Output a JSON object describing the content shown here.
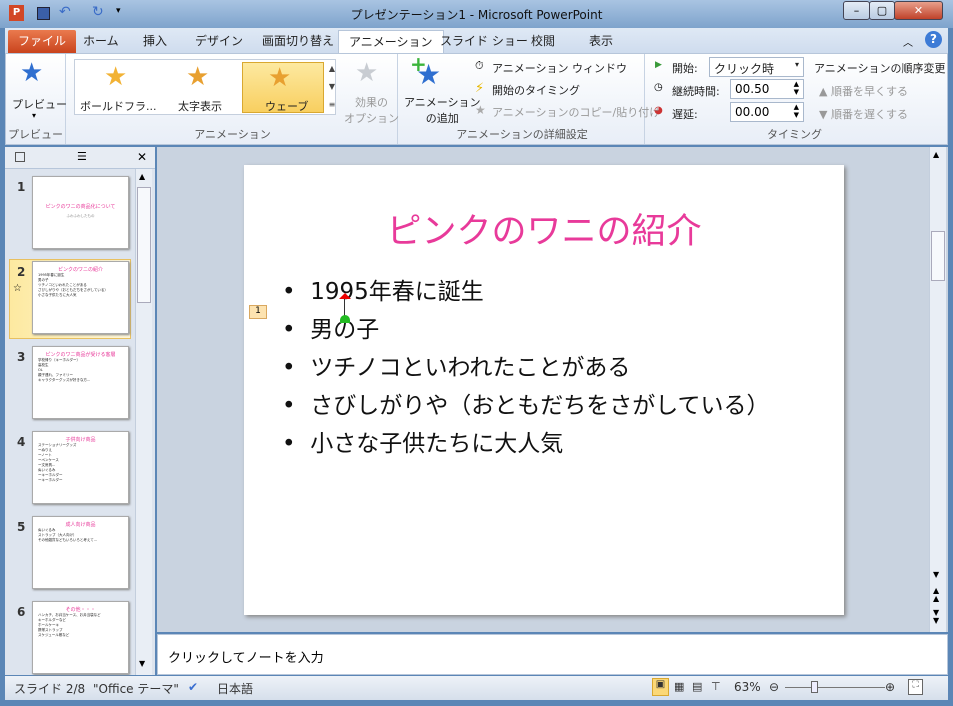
{
  "window": {
    "title": "プレゼンテーション1 - Microsoft PowerPoint",
    "min": "–",
    "max": "▢",
    "close": "✕"
  },
  "tabs": [
    "ファイル",
    "ホーム",
    "挿入",
    "デザイン",
    "画面切り替え",
    "アニメーション",
    "スライド ショー",
    "校閲",
    "表示"
  ],
  "ribbon": {
    "preview": {
      "label": "プレビュー",
      "group": "プレビュー"
    },
    "animations": {
      "items": [
        "ボールドフラ...",
        "太字表示",
        "ウェーブ"
      ],
      "selected": "ウェーブ",
      "effect_options": "効果の\nオプション",
      "group": "アニメーション"
    },
    "advanced": {
      "add": "アニメーション\nの追加",
      "pane": "アニメーション ウィンドウ",
      "trigger": "開始のタイミング",
      "painter": "アニメーションのコピー/貼り付け",
      "group": "アニメーションの詳細設定"
    },
    "timing": {
      "start_label": "開始:",
      "start_value": "クリック時",
      "duration_label": "継続時間:",
      "duration_value": "00.50",
      "delay_label": "遅延:",
      "delay_value": "00.00",
      "reorder": "アニメーションの順序変更",
      "earlier": "順番を早くする",
      "later": "順番を遅くする",
      "group": "タイミング"
    }
  },
  "slides": [
    {
      "num": "1",
      "title": "ピンクのワニの商品化について",
      "lines": [
        "ふわふわしたもの"
      ]
    },
    {
      "num": "2",
      "title": "ピンクのワニの紹介",
      "lines": [
        "1995年春に誕生",
        "男の子",
        "ツチノコといわれたことがある",
        "さびしがりや（おともだちをさがしている）",
        "小さな子供たちに大人気"
      ]
    },
    {
      "num": "3",
      "title": "ピンクのワニ商品が受ける客層",
      "lines": [
        "学校帰り（キーホルダー）",
        "高校生",
        "OL",
        "親子連れ、ファミリー",
        "キャラクターグッズが好きな方..."
      ]
    },
    {
      "num": "4",
      "title": "子供向け商品",
      "lines": [
        "ステーショナリーグッズ",
        "ーぬりえ",
        "ーノート",
        "ーペンケース",
        "ー文房具...",
        "ぬいぐるみ",
        "ーキーホルダー",
        "ーキーホルダー"
      ]
    },
    {
      "num": "5",
      "title": "成人向け商品",
      "lines": [
        "ぬいぐるみ",
        "ストラップ（大人向け）",
        "その他雑貨などもいろいろと考えて..."
      ]
    },
    {
      "num": "6",
      "title": "その他・・・",
      "lines": [
        "ハンカチ、お弁当ケース、お弁当袋など",
        "キーホルダーなど",
        "ホールケーキ",
        "携帯ストラップ",
        "スケジュール帳など"
      ]
    }
  ],
  "current_slide": {
    "title": "ピンクのワニの紹介",
    "bullets": [
      "1995年春に誕生",
      "男の子",
      "ツチノコといわれたことがある",
      "さびしがりや（おともだちをさがしている）",
      "小さな子供たちに大人気"
    ],
    "anim_tag": "1"
  },
  "notes_placeholder": "クリックしてノートを入力",
  "status": {
    "slide": "スライド 2/8",
    "theme": "\"Office テーマ\"",
    "language": "日本語",
    "zoom": "63%",
    "zoom_level": 0.63
  },
  "colors": {
    "accent": "#e83a9a",
    "file_tab": "#d4532a",
    "selected": "#fbd877"
  }
}
